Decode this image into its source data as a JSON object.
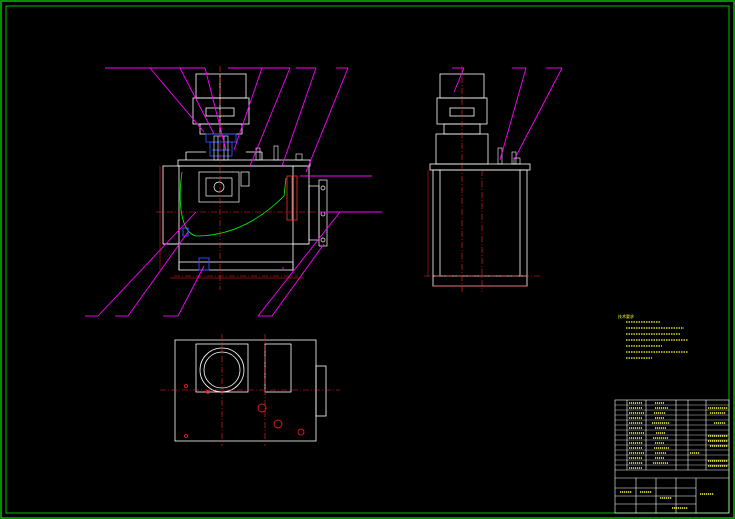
{
  "drawing": {
    "type": "cad-assembly-drawing",
    "background": "#000000",
    "colors": {
      "border": "#00c000",
      "outline": "#ffffff",
      "leader": "#ff00ff",
      "centerline": "#ff2020",
      "text": "#ffff33",
      "hidden": "#00ff00",
      "accent_blue": "#3050ff"
    },
    "notes_title": "技术要求"
  }
}
